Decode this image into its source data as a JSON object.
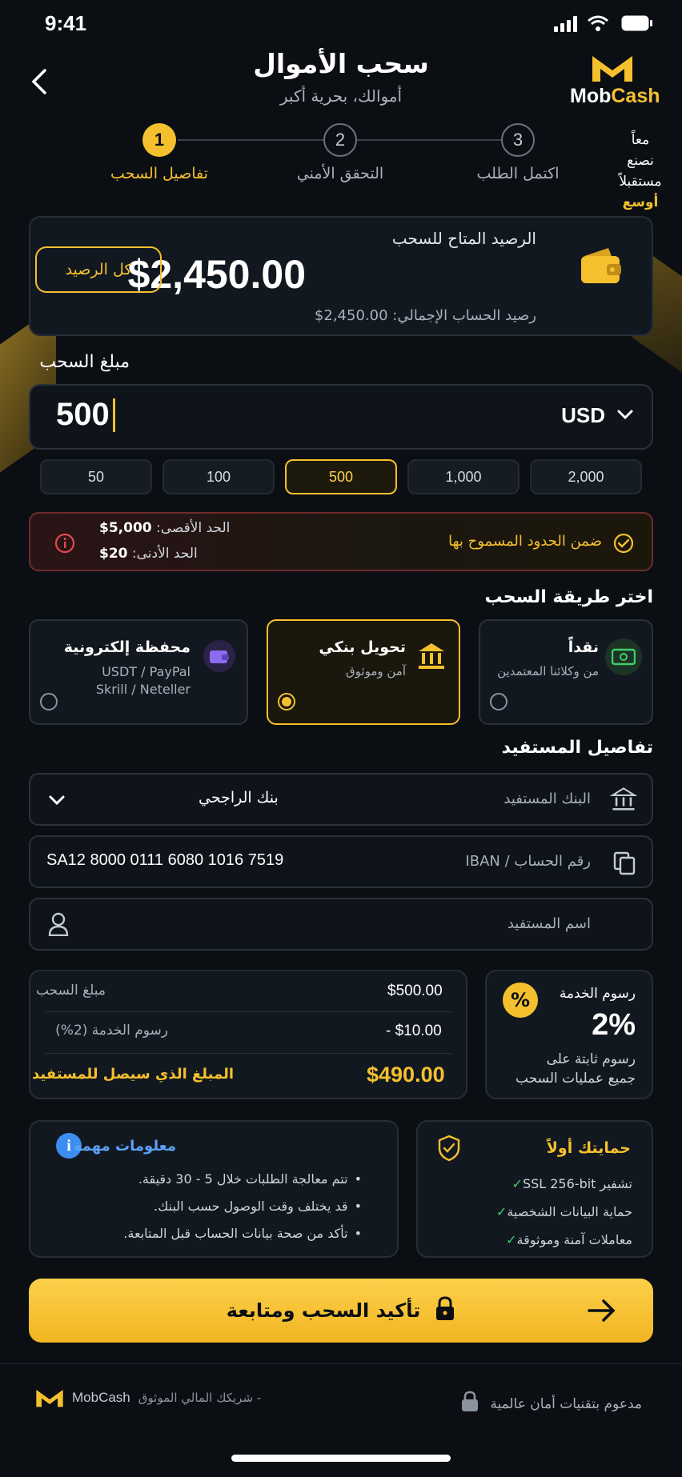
{
  "status_bar": {
    "time": "9:41"
  },
  "header": {
    "title": "سحب الأموال",
    "subtitle": "أموالك، بحرية أكبر",
    "brand_name_1": "Mob",
    "brand_name_2": "Cash",
    "slogan_1": "معاً",
    "slogan_2": "نصنع",
    "slogan_3": "مستقبلاً",
    "slogan_4": "أوسع"
  },
  "steps": [
    {
      "number": "1",
      "label": "تفاصيل السحب"
    },
    {
      "number": "2",
      "label": "التحقق الأمني"
    },
    {
      "number": "3",
      "label": "اكتمل الطلب"
    }
  ],
  "balance": {
    "label": "الرصيد المتاح للسحب",
    "amount": "$2,450.00",
    "total_label": "رصيد الحساب الإجمالي:",
    "total_value": "$2,450.00",
    "all_button": "كل الرصيد"
  },
  "amount": {
    "section_title": "مبلغ السحب",
    "value": "500",
    "currency": "USD",
    "quick_amounts": [
      "2,000",
      "1,000",
      "500",
      "100",
      "50"
    ],
    "selected": "500"
  },
  "limits": {
    "status": "ضمن الحدود المسموح بها",
    "max_label": "الحد الأقصى:",
    "max_value": "$5,000",
    "min_label": "الحد الأدنى:",
    "min_value": "$20"
  },
  "methods": {
    "section_title": "اختر طريقة السحب",
    "items": [
      {
        "title": "نقداً",
        "desc_1": "من وكلائنا المعتمدين",
        "desc_2": ""
      },
      {
        "title": "تحويل بنكي",
        "desc_1": "آمن وموثوق",
        "desc_2": ""
      },
      {
        "title": "محفظة إلكترونية",
        "desc_1": "USDT / PayPal",
        "desc_2": "Skrill / Neteller"
      }
    ],
    "selected_index": 1
  },
  "beneficiary": {
    "section_title": "تفاصيل المستفيد",
    "bank_label": "البنك المستفيد",
    "bank_value": "بنك الراجحي",
    "iban_label": "رقم الحساب / IBAN",
    "iban_value": "SA12 8000 0111 6080 1016 7519",
    "name_placeholder": "اسم المستفيد"
  },
  "fees": {
    "title": "رسوم الخدمة",
    "percent": "2%",
    "desc_1": "رسوم ثابتة على",
    "desc_2": "جميع عمليات السحب"
  },
  "summary": {
    "amount_label": "مبلغ السحب",
    "amount_value": "$500.00",
    "fee_label": "رسوم الخدمة (2%)",
    "fee_value": "- $10.00",
    "net_label": "المبلغ الذي سيصل للمستفيد",
    "net_value": "$490.00"
  },
  "protection": {
    "title": "حمايتك أولاً",
    "items": [
      "تشفير SSL 256-bit",
      "حماية البيانات الشخصية",
      "معاملات آمنة وموثوقة"
    ]
  },
  "info": {
    "title": "معلومات مهمة",
    "items": [
      "تتم معالجة الطلبات خلال 5 - 30 دقيقة.",
      "قد يختلف وقت الوصول حسب البنك.",
      "تأكد من صحة بيانات الحساب قبل المتابعة."
    ]
  },
  "cta": {
    "label": "تأكيد السحب ومتابعة"
  },
  "footer": {
    "security_text": "مدعوم بتقنيات أمان عالمية",
    "brand_text": "MobCash",
    "tagline": "- شريكك المالي الموثوق"
  },
  "colors": {
    "accent": "#f5c02e",
    "background": "#0b0f14",
    "card": "#121820",
    "success": "#3ecf6b",
    "danger": "#e5484d",
    "info": "#3b8ef0"
  }
}
